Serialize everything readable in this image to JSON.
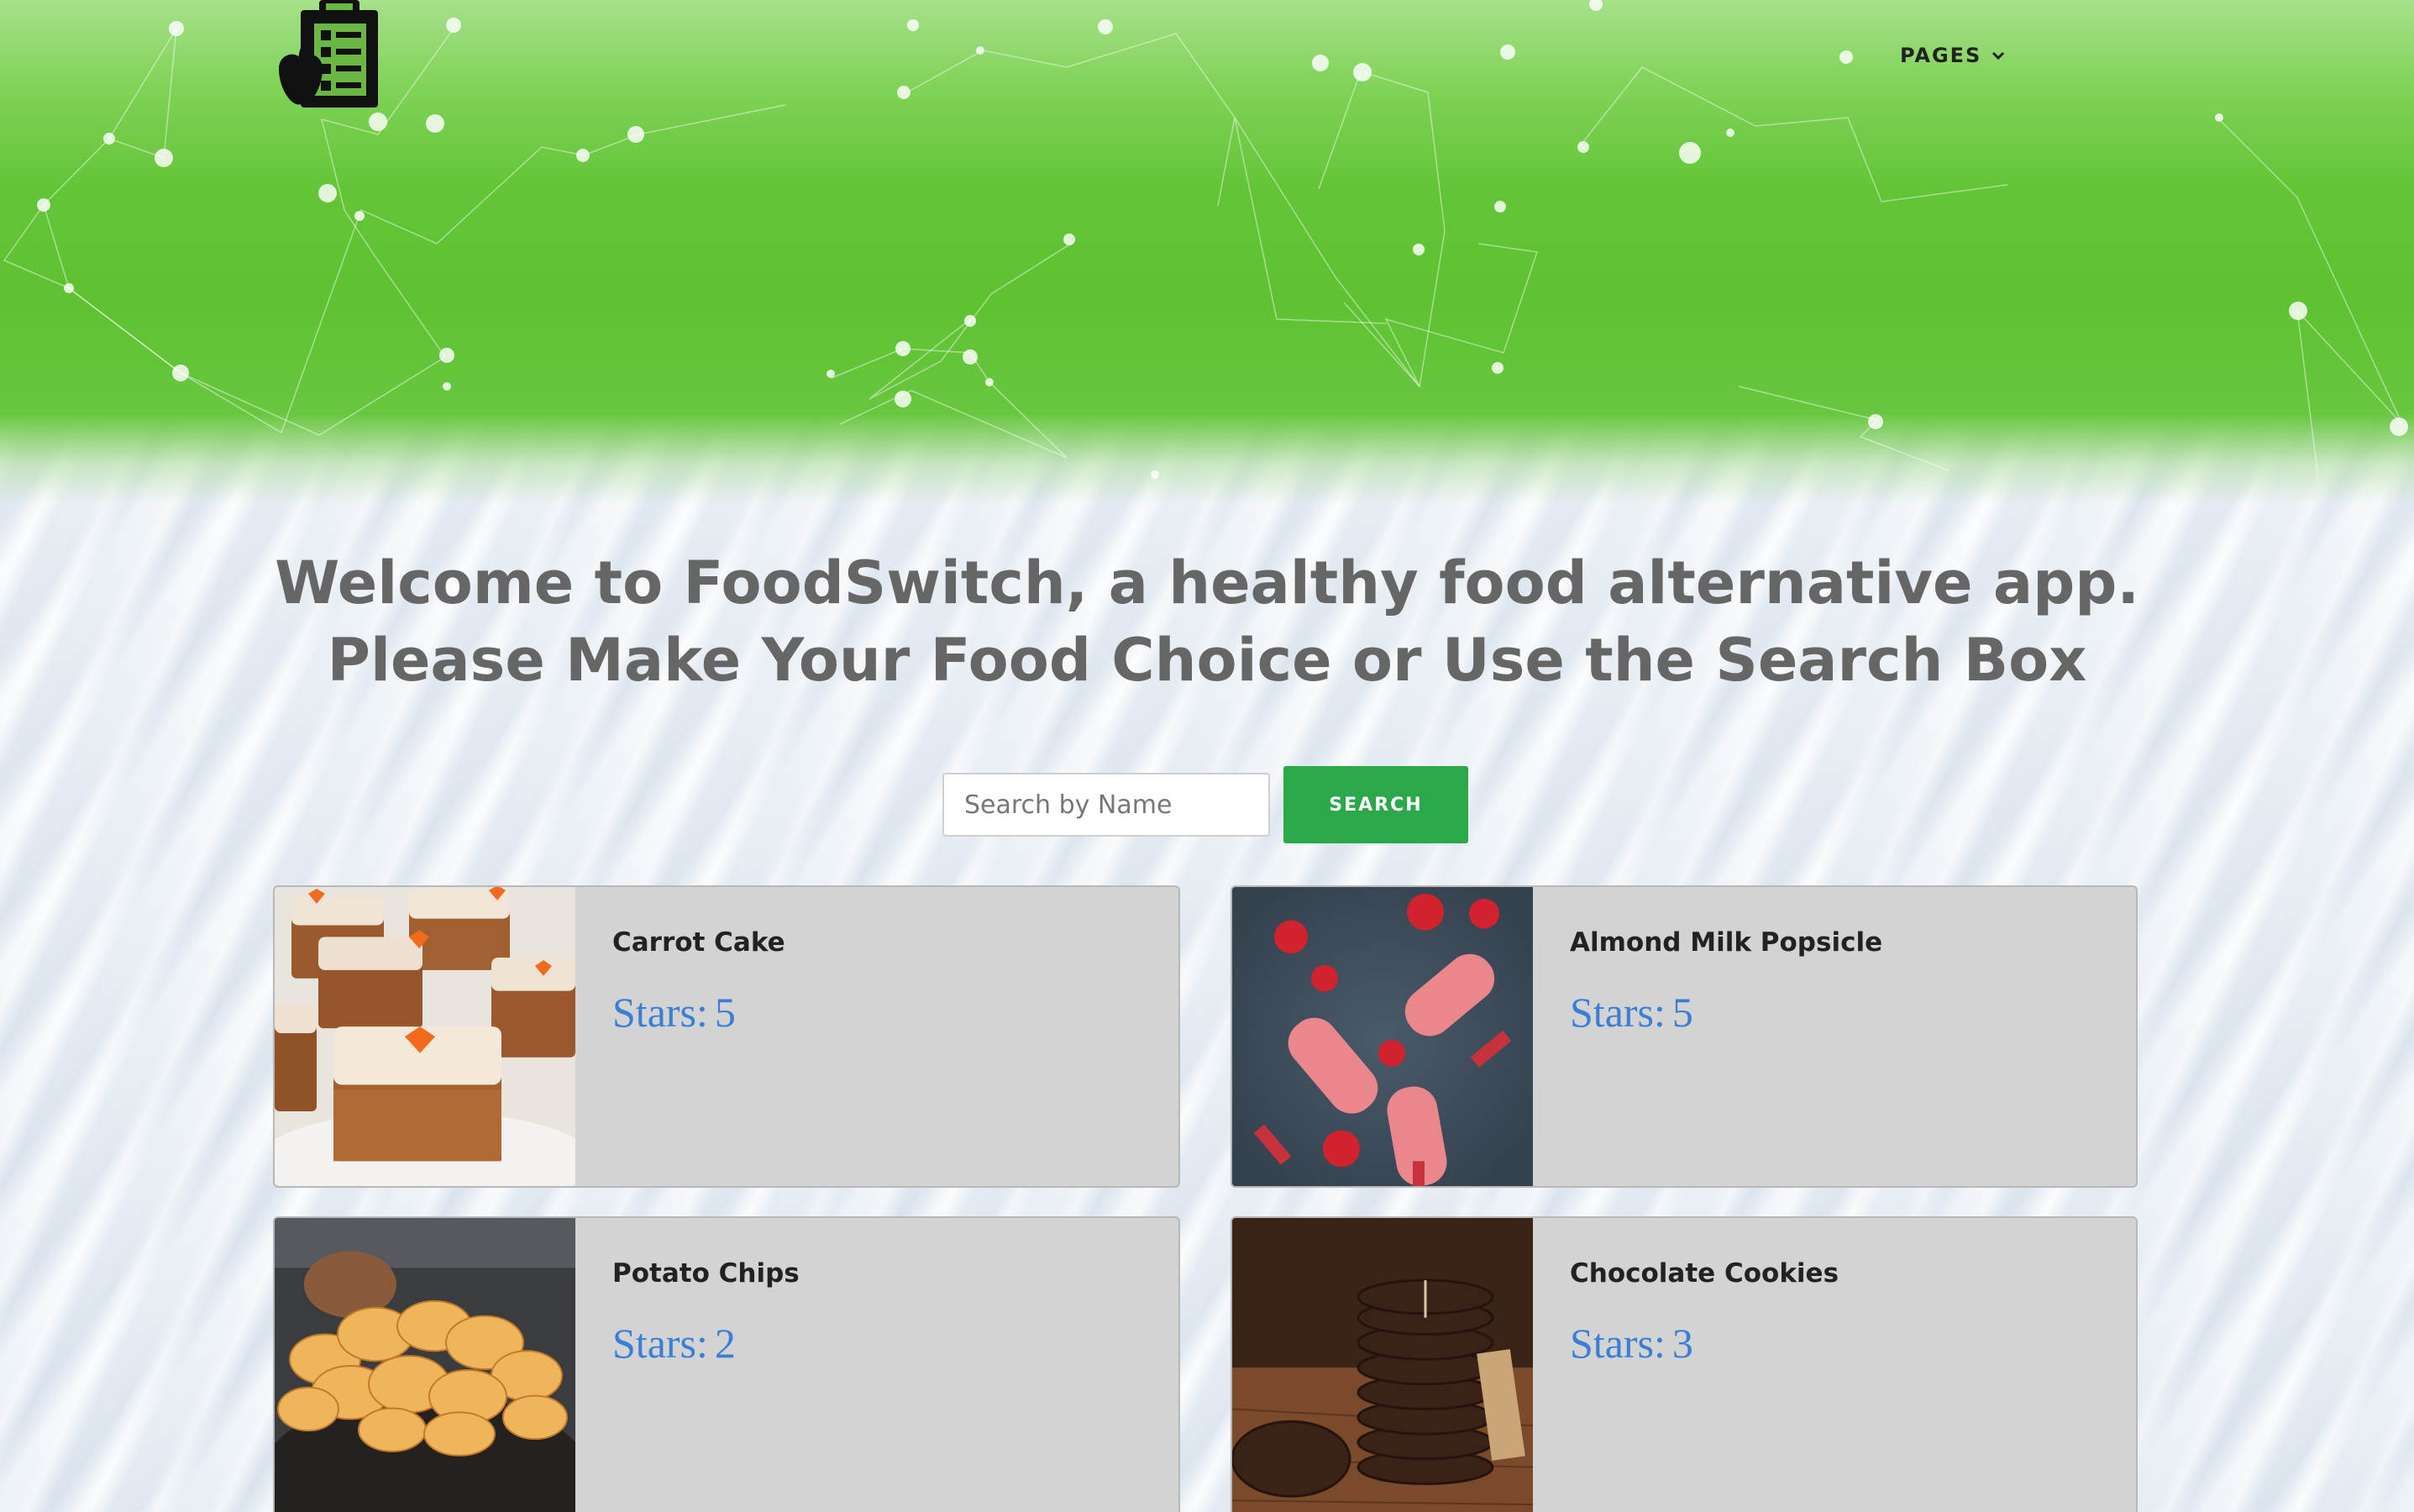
{
  "app": {
    "logo_icon": "food-checklist-apple-icon",
    "brand_green": "#5fc232",
    "accent_blue": "#3a7fd5"
  },
  "nav": {
    "pages_label": "PAGES",
    "chevron_icon": "chevron-down-icon"
  },
  "hero": {
    "line1": "Welcome to FoodSwitch, a healthy food alternative app.",
    "line2": "Please Make Your Food Choice or Use the Search Box"
  },
  "search": {
    "placeholder": "Search by Name",
    "value": "",
    "button_label": "SEARCH",
    "button_color": "#2aa84a"
  },
  "foods": [
    {
      "name": "Carrot Cake",
      "stars_label": "Stars:",
      "stars": "5",
      "image": "carrot-cake-photo"
    },
    {
      "name": "Almond Milk Popsicle",
      "stars_label": "Stars:",
      "stars": "5",
      "image": "strawberry-popsicle-photo"
    },
    {
      "name": "Potato Chips",
      "stars_label": "Stars:",
      "stars": "2",
      "image": "potato-chips-photo"
    },
    {
      "name": "Chocolate Cookies",
      "stars_label": "Stars:",
      "stars": "3",
      "image": "chocolate-cookies-photo"
    }
  ]
}
